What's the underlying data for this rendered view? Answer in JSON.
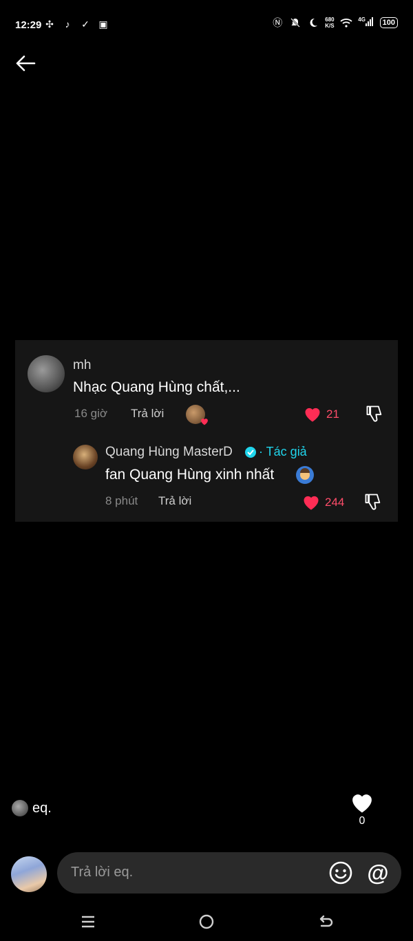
{
  "status_bar": {
    "time": "12:29",
    "net_speed_value": "680",
    "net_speed_unit": "K/S",
    "signal_label": "4G",
    "battery": "100"
  },
  "comments": {
    "main": {
      "author": "mh",
      "text": "Nhạc Quang Hùng chất,...",
      "time": "16 giờ",
      "reply_label": "Trả lời",
      "likes": "21"
    },
    "reply": {
      "author": "Quang Hùng MasterD",
      "author_tag": "· Tác giả",
      "text": "fan Quang Hùng xinh nhất",
      "time": "8 phút",
      "reply_label": "Trả lời",
      "likes": "244"
    }
  },
  "post": {
    "author": "eq.",
    "like_count": "0"
  },
  "reply_bar": {
    "placeholder": "Trả lời eq."
  },
  "colors": {
    "background": "#000000",
    "accent_like": "#ff4d6a",
    "verified": "#20d5ec"
  }
}
